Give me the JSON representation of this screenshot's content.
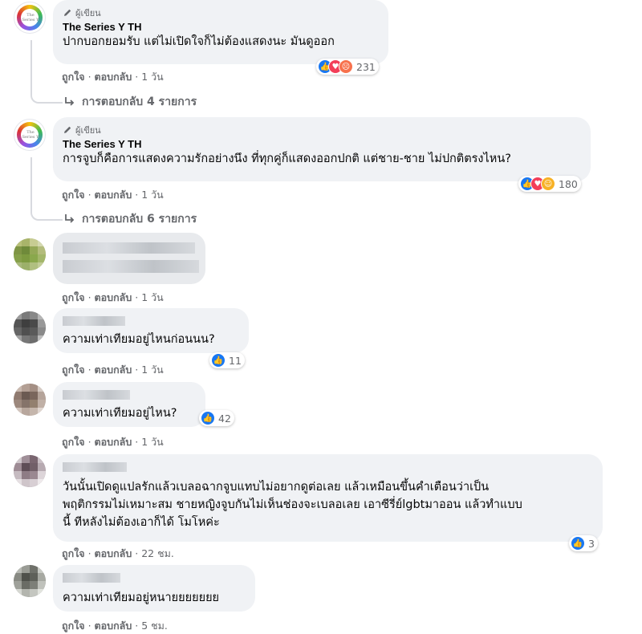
{
  "actions": {
    "like": "ถูกใจ",
    "reply": "ตอบกลับ",
    "dot": "·"
  },
  "comments": [
    {
      "author_badge": "ผู้เขียน",
      "name": "The Series Y TH",
      "text": "ปากบอกยอมรับ แต่ไม่เปิดใจก็ไม่ต้องแสดงนะ มันดูออก",
      "time": "1 วัน",
      "reactions": [
        "like",
        "love",
        "angry"
      ],
      "reaction_count": "231",
      "replies": "การตอบกลับ 4 รายการ"
    },
    {
      "author_badge": "ผู้เขียน",
      "name": "The Series Y TH",
      "text": "การจูบก็คือการแสดงความรักอย่างนึง ที่ทุกคู่ก็แสดงออกปกติ แต่ชาย-ชาย ไม่ปกติตรงไหน?",
      "time": "1 วัน",
      "reactions": [
        "like",
        "love",
        "care"
      ],
      "reaction_count": "180",
      "replies": "การตอบกลับ 6 รายการ"
    },
    {
      "text": "",
      "time": "1 วัน"
    },
    {
      "text": "ความเท่าเทียมอยู่ไหนก่อนนน?",
      "time": "1 วัน",
      "reactions": [
        "like"
      ],
      "reaction_count": "11"
    },
    {
      "text": "ความเท่าเทียมอยู่ไหน?",
      "time": "1 วัน",
      "reactions": [
        "like"
      ],
      "reaction_count": "42"
    },
    {
      "lines": [
        "วันนั้นเปิดดูแปลรักแล้วเบลอฉากจูบแทบไม่อยากดูต่อเลย แล้วเหมือนขึ้นคำเตือนว่าเป็น",
        "พฤติกรรมไม่เหมาะสม ชายหญิงจูบกันไม่เห็นช่องจะเบลอเลย เอาซีรี่ย์lgbtมาออน แล้วทำแบบ",
        "นี้ ทีหลังไม่ต้องเอาก็ได้ โมโหค่ะ"
      ],
      "time": "22 ชม.",
      "reactions": [
        "like"
      ],
      "reaction_count": "3"
    },
    {
      "text": "ความเท่าเทียมอยู่หนายยยยยยย",
      "time": "5 ชม."
    }
  ],
  "icons": {
    "pencil": "pencil-icon",
    "reply_arrow": "reply-arrow-icon",
    "like": "like-icon",
    "love": "love-icon",
    "angry": "angry-icon",
    "care": "care-icon"
  },
  "colors": {
    "bubble": "#f0f2f5",
    "meta": "#65676b",
    "like": "#1877f2",
    "love": "#f33e58"
  }
}
